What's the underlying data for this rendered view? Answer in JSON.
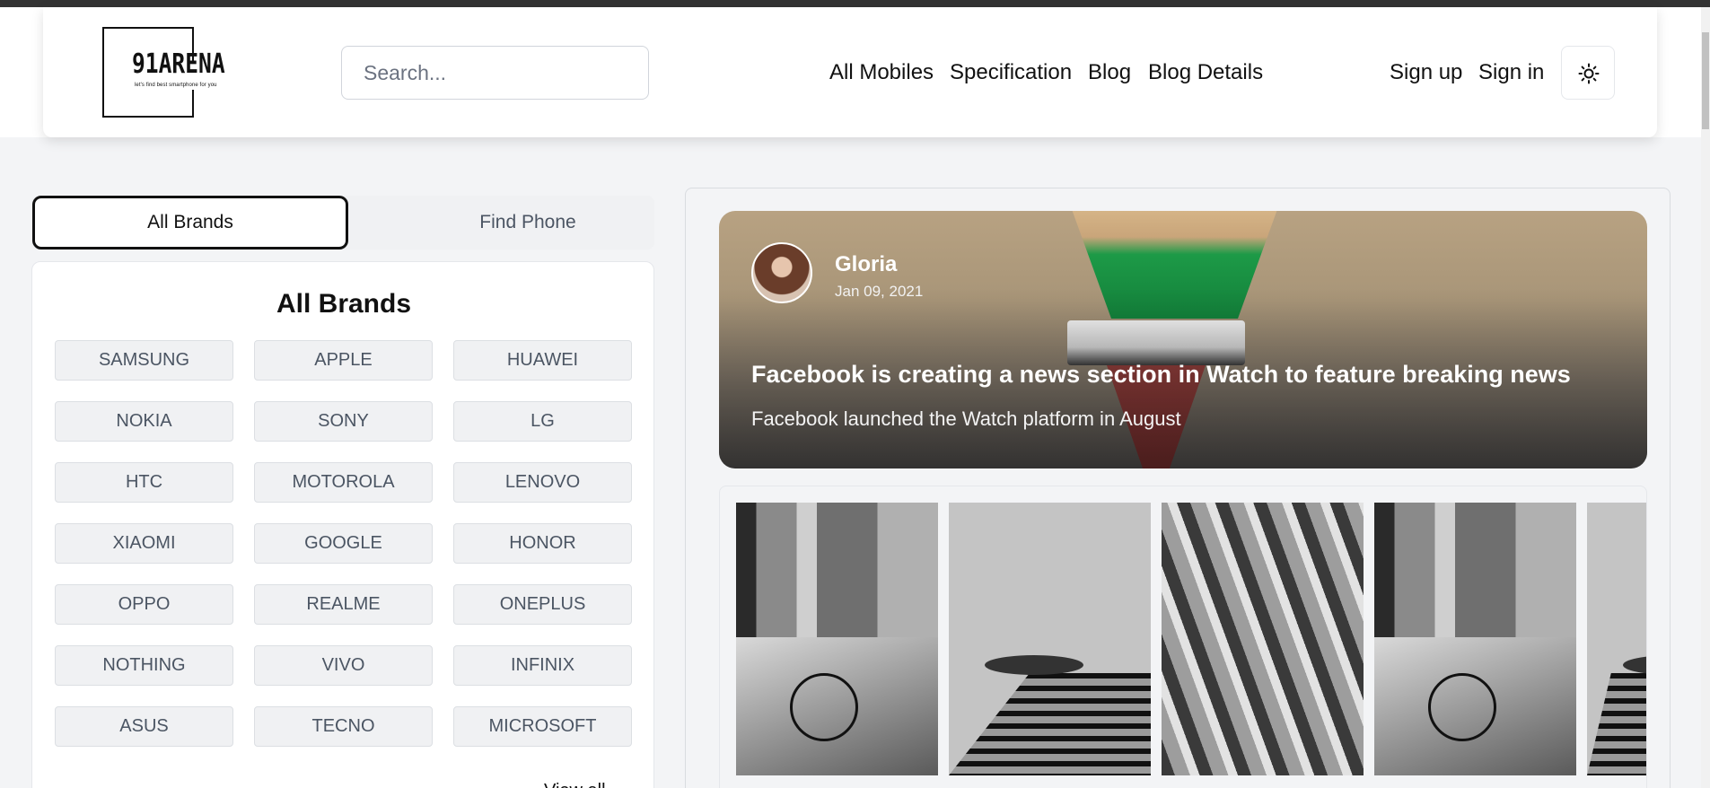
{
  "header": {
    "logo": {
      "title": "91ARENA",
      "tagline": "let's find best smartphone for you"
    },
    "search_placeholder": "Search...",
    "nav": [
      "All Mobiles",
      "Specification",
      "Blog",
      "Blog Details"
    ],
    "auth": {
      "signup": "Sign up",
      "signin": "Sign in"
    },
    "theme_icon": "sun-icon"
  },
  "tabs": {
    "active": "All Brands",
    "inactive": "Find Phone"
  },
  "brands": {
    "title": "All Brands",
    "items": [
      "SAMSUNG",
      "APPLE",
      "HUAWEI",
      "NOKIA",
      "SONY",
      "LG",
      "HTC",
      "MOTOROLA",
      "LENOVO",
      "XIAOMI",
      "GOOGLE",
      "HONOR",
      "OPPO",
      "REALME",
      "ONEPLUS",
      "NOTHING",
      "VIVO",
      "INFINIX",
      "ASUS",
      "TECNO",
      "MICROSOFT"
    ],
    "view_all": "View all"
  },
  "featured_post": {
    "author": "Gloria",
    "date": "Jan 09, 2021",
    "title": "Facebook is creating a news section in Watch to feature breaking news",
    "subtitle": "Facebook launched the Watch platform in August"
  },
  "gallery": [
    "street-bicycle-photo",
    "stairs-photo",
    "building-photo",
    "street-bicycle-photo",
    "stairs-photo"
  ]
}
